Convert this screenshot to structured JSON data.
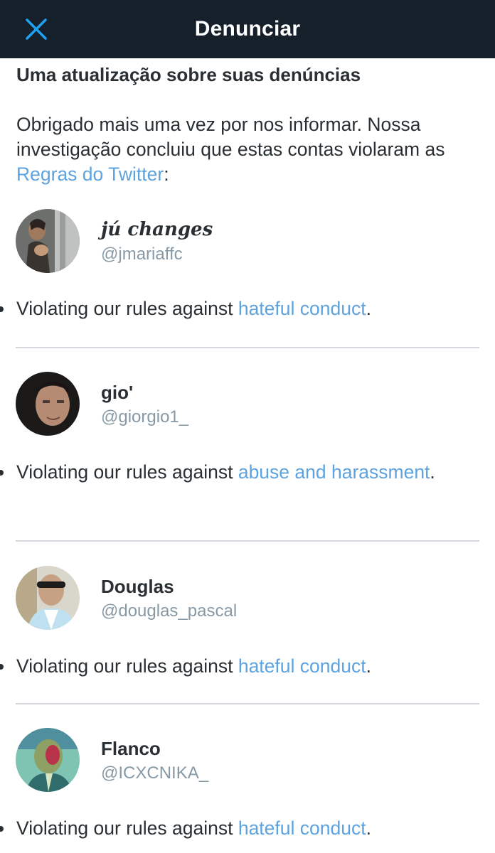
{
  "header": {
    "title": "Denunciar",
    "close_icon": "close-icon"
  },
  "main": {
    "heading": "Uma atualização sobre suas denúncias",
    "intro_text": "Obrigado mais uma vez por nos informar. Nossa investigação concluiu que estas contas violaram as ",
    "intro_link": "Regras do Twitter",
    "intro_end": ":"
  },
  "accounts": [
    {
      "name": "jú changes",
      "handle": "@jmariaffc",
      "violation_prefix": "Violating our rules against ",
      "violation_link": "hateful conduct",
      "violation_suffix": "."
    },
    {
      "name": "gio'",
      "handle": "@giorgio1_",
      "violation_prefix": "Violating our rules against ",
      "violation_link": "abuse and harassment",
      "violation_suffix": "."
    },
    {
      "name": "Douglas",
      "handle": "@douglas_pascal",
      "violation_prefix": "Violating our rules against ",
      "violation_link": "hateful conduct",
      "violation_suffix": "."
    },
    {
      "name": "Flanco",
      "handle": "@ICXCNIKA_",
      "violation_prefix": "Violating our rules against ",
      "violation_link": "hateful conduct",
      "violation_suffix": "."
    }
  ],
  "colors": {
    "header_bg": "#15202b",
    "accent": "#1da1f2",
    "link": "#5da3e0",
    "divider": "#d4d8dc"
  }
}
